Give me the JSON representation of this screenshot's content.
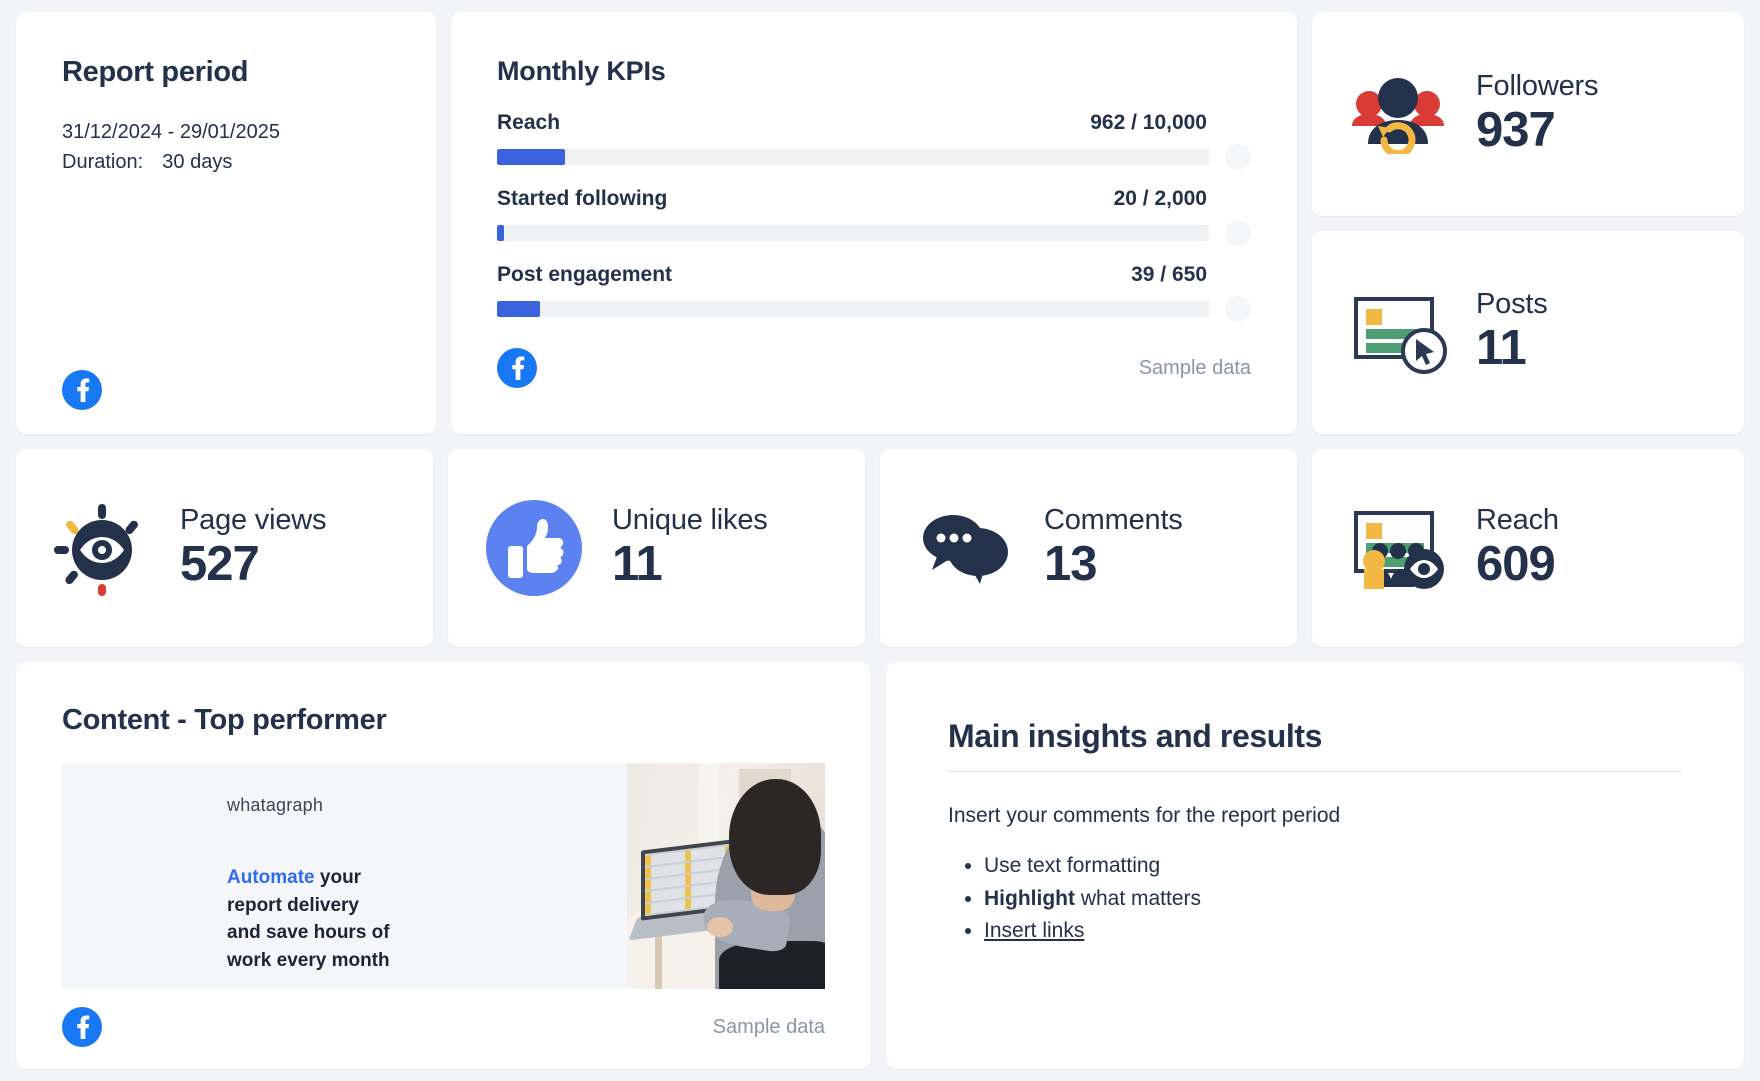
{
  "report": {
    "title": "Report period",
    "range": "31/12/2024 - 29/01/2025",
    "duration_label": "Duration:",
    "duration_value": "30 days",
    "source_icon": "facebook-icon"
  },
  "kpi": {
    "title": "Monthly KPIs",
    "sample_label": "Sample data",
    "source_icon": "facebook-icon",
    "items": [
      {
        "label": "Reach",
        "value": "962 / 10,000",
        "current": 962,
        "target": 10000,
        "percent": 9.6
      },
      {
        "label": "Started following",
        "value": "20 / 2,000",
        "current": 20,
        "target": 2000,
        "percent": 1.0
      },
      {
        "label": "Post engagement",
        "value": "39 / 650",
        "current": 39,
        "target": 650,
        "percent": 6.0
      }
    ]
  },
  "stats": {
    "followers": {
      "label": "Followers",
      "value": "937",
      "icon": "followers-group-icon"
    },
    "posts": {
      "label": "Posts",
      "value": "11",
      "icon": "posts-document-cursor-icon"
    },
    "page_views": {
      "label": "Page views",
      "value": "527",
      "icon": "eye-views-icon"
    },
    "unique_likes": {
      "label": "Unique likes",
      "value": "11",
      "icon": "thumbs-up-icon"
    },
    "comments": {
      "label": "Comments",
      "value": "13",
      "icon": "speech-bubbles-icon"
    },
    "reach": {
      "label": "Reach",
      "value": "609",
      "icon": "reach-audience-icon"
    }
  },
  "content": {
    "title": "Content - Top performer",
    "sample_label": "Sample data",
    "source_icon": "facebook-icon",
    "creative": {
      "brand": "whatagraph",
      "headline_accent": "Automate",
      "headline_rest": " your",
      "headline_line2": "report delivery",
      "headline_line3": "and save hours of",
      "headline_line4": "work every month"
    }
  },
  "insights": {
    "title": "Main insights and results",
    "lead": "Insert your comments for the report period",
    "bullets": [
      {
        "text": "Use text formatting",
        "style": "plain"
      },
      {
        "bold": "Highlight",
        "rest": " what matters",
        "style": "bold-prefix"
      },
      {
        "text": "Insert links",
        "style": "underline"
      }
    ]
  },
  "colors": {
    "accent_blue": "#3b63dd",
    "facebook_blue": "#1877f2",
    "like_blue": "#5b82f0",
    "navy": "#23314a",
    "red": "#da3b36",
    "yellow": "#f2b844",
    "green": "#4e9e74",
    "track": "#eff1f3",
    "page_bg": "#f2f4f7"
  }
}
